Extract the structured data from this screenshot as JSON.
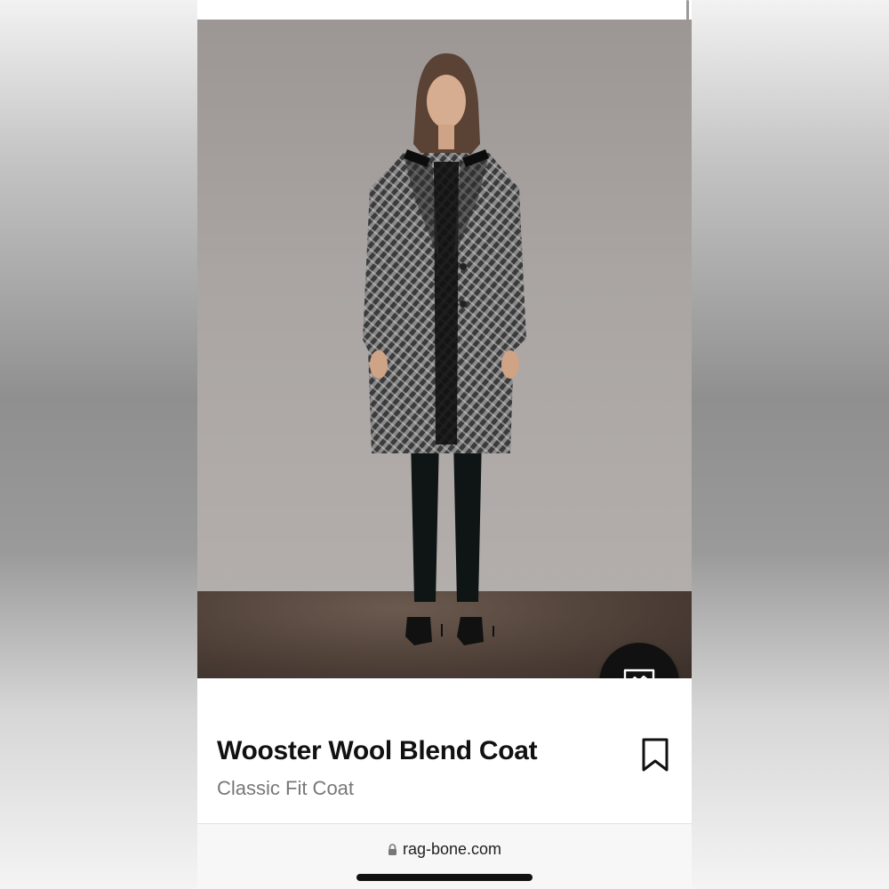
{
  "product": {
    "title": "Wooster Wool Blend Coat",
    "subtitle": "Classic Fit Coat"
  },
  "browser": {
    "url": "rag-bone.com"
  },
  "icons": {
    "chat": "chat-bubble-icon",
    "bookmark": "bookmark-icon",
    "lock": "lock-icon"
  },
  "colors": {
    "chat_button": "#111111",
    "title": "#111111",
    "subtitle": "#777777"
  }
}
